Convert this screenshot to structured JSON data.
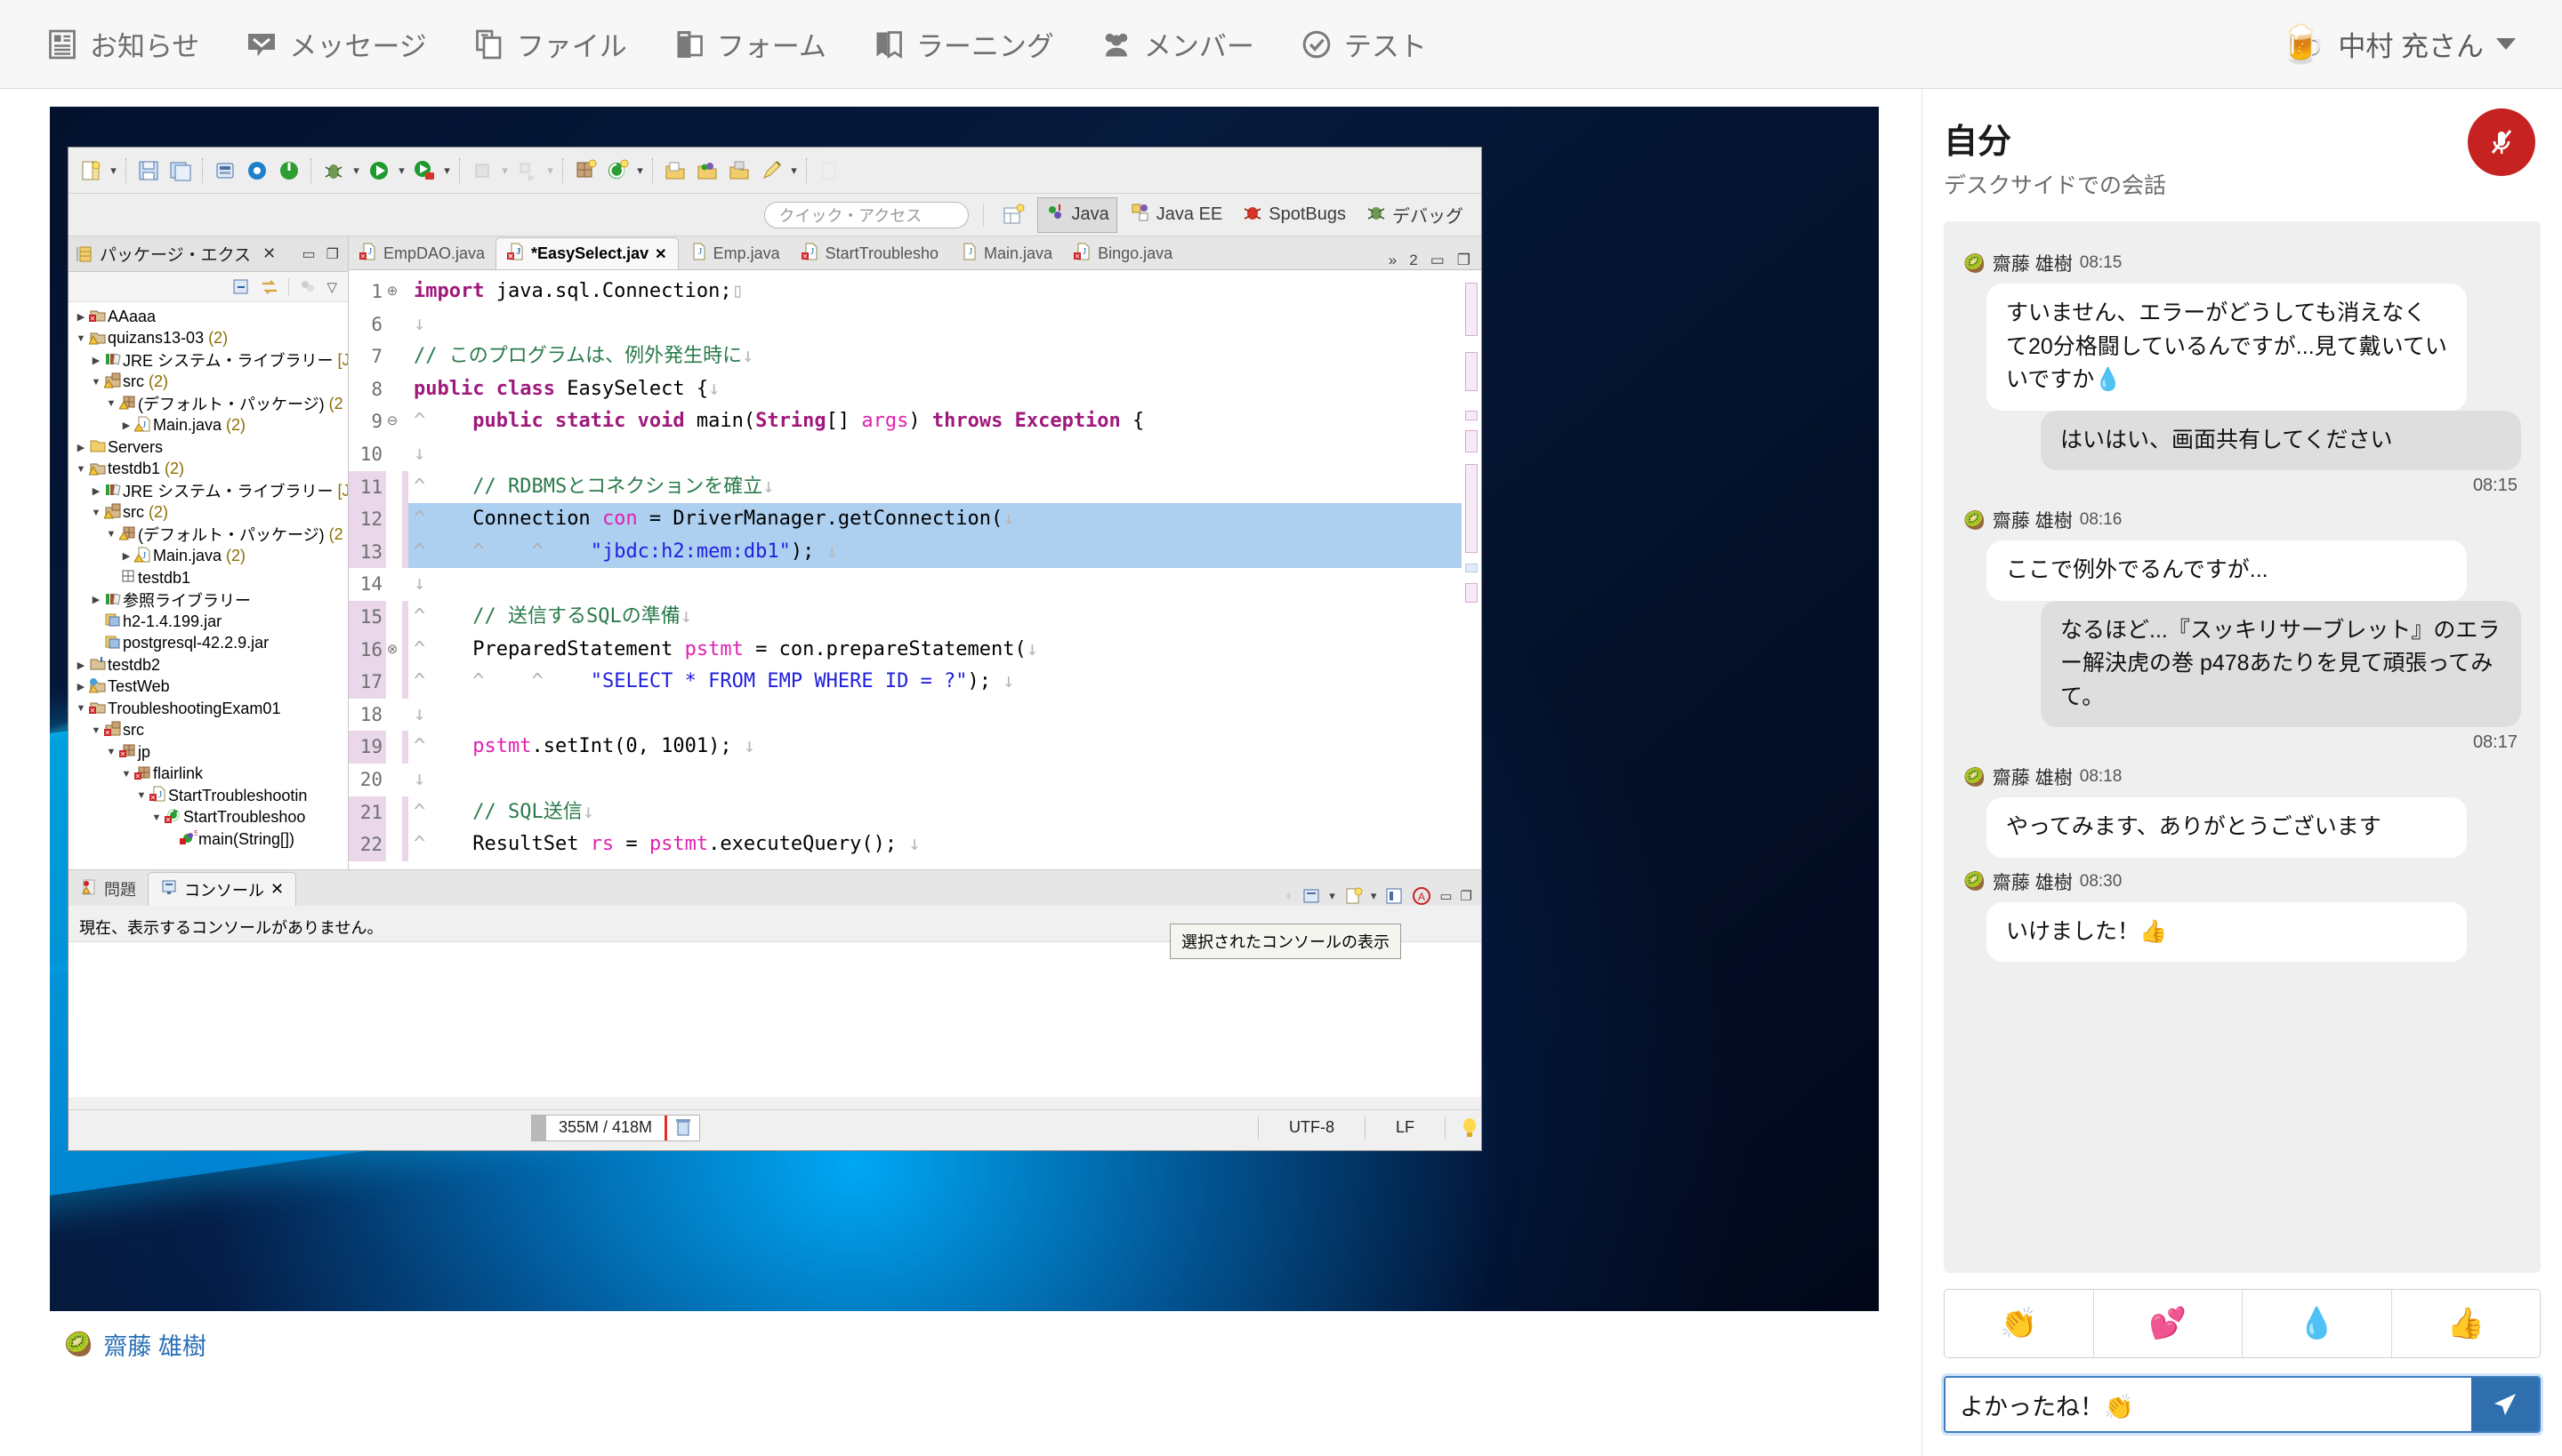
{
  "topnav": {
    "items": [
      {
        "label": "お知らせ",
        "icon": "announcement-icon"
      },
      {
        "label": "メッセージ",
        "icon": "message-icon"
      },
      {
        "label": "ファイル",
        "icon": "file-icon"
      },
      {
        "label": "フォーム",
        "icon": "form-icon"
      },
      {
        "label": "ラーニング",
        "icon": "learning-icon"
      },
      {
        "label": "メンバー",
        "icon": "members-icon"
      },
      {
        "label": "テスト",
        "icon": "test-icon"
      }
    ],
    "user": {
      "name": "中村 充さん",
      "avatar_emoji": "🍺"
    }
  },
  "eclipse": {
    "quick_access_placeholder": "クイック・アクセス",
    "perspectives": [
      {
        "label": "Java",
        "active": true
      },
      {
        "label": "Java EE",
        "active": false
      },
      {
        "label": "SpotBugs",
        "active": false
      },
      {
        "label": "デバッグ",
        "active": false
      }
    ],
    "package_explorer": {
      "title": "パッケージ・エクス",
      "tree": [
        {
          "indent": 0,
          "twist": "▶",
          "icon": "project-error-icon",
          "label": "AAaaa",
          "count": ""
        },
        {
          "indent": 0,
          "twist": "▼",
          "icon": "project-warn-icon",
          "label": "quizans13-03",
          "count": "(2)"
        },
        {
          "indent": 1,
          "twist": "▶",
          "icon": "library-icon",
          "label": "JRE システム・ライブラリー",
          "count": "[Ja"
        },
        {
          "indent": 1,
          "twist": "▼",
          "icon": "source-folder-icon",
          "label": "src",
          "count": "(2)"
        },
        {
          "indent": 2,
          "twist": "▼",
          "icon": "package-icon",
          "label": "(デフォルト・パッケージ)",
          "count": "(2"
        },
        {
          "indent": 3,
          "twist": "▶",
          "icon": "java-file-icon",
          "label": "Main.java",
          "count": "(2)"
        },
        {
          "indent": 0,
          "twist": "▶",
          "icon": "folder-icon",
          "label": "Servers",
          "count": ""
        },
        {
          "indent": 0,
          "twist": "▼",
          "icon": "project-warn-icon",
          "label": "testdb1",
          "count": "(2)"
        },
        {
          "indent": 1,
          "twist": "▶",
          "icon": "library-icon",
          "label": "JRE システム・ライブラリー",
          "count": "[Ja"
        },
        {
          "indent": 1,
          "twist": "▼",
          "icon": "source-folder-icon",
          "label": "src",
          "count": "(2)"
        },
        {
          "indent": 2,
          "twist": "▼",
          "icon": "package-icon",
          "label": "(デフォルト・パッケージ)",
          "count": "(2"
        },
        {
          "indent": 3,
          "twist": "▶",
          "icon": "java-file-icon",
          "label": "Main.java",
          "count": "(2)"
        },
        {
          "indent": 2,
          "twist": "",
          "icon": "package-plain-icon",
          "label": "testdb1",
          "count": ""
        },
        {
          "indent": 1,
          "twist": "▶",
          "icon": "library-icon",
          "label": "参照ライブラリー",
          "count": ""
        },
        {
          "indent": 1,
          "twist": "",
          "icon": "jar-icon",
          "label": "h2-1.4.199.jar",
          "count": ""
        },
        {
          "indent": 1,
          "twist": "",
          "icon": "jar-icon",
          "label": "postgresql-42.2.9.jar",
          "count": ""
        },
        {
          "indent": 0,
          "twist": "▶",
          "icon": "project-icon",
          "label": "testdb2",
          "count": ""
        },
        {
          "indent": 0,
          "twist": "▶",
          "icon": "web-project-icon",
          "label": "TestWeb",
          "count": ""
        },
        {
          "indent": 0,
          "twist": "▼",
          "icon": "project-error-icon",
          "label": "TroubleshootingExam01",
          "count": ""
        },
        {
          "indent": 1,
          "twist": "▼",
          "icon": "source-folder-error-icon",
          "label": "src",
          "count": ""
        },
        {
          "indent": 2,
          "twist": "▼",
          "icon": "package-error-icon",
          "label": "jp",
          "count": ""
        },
        {
          "indent": 3,
          "twist": "▼",
          "icon": "package-error-icon",
          "label": "flairlink",
          "count": ""
        },
        {
          "indent": 4,
          "twist": "▼",
          "icon": "java-file-error-icon",
          "label": "StartTroubleshootin",
          "count": ""
        },
        {
          "indent": 5,
          "twist": "▼",
          "icon": "class-error-icon",
          "label": "StartTroubleshoo",
          "count": ""
        },
        {
          "indent": 6,
          "twist": "",
          "icon": "method-static-icon",
          "label": "main(String[])",
          "count": ""
        }
      ]
    },
    "editor_tabs": [
      {
        "label": "EmpDAO.java",
        "active": false,
        "error": true
      },
      {
        "label": "*EasySelect.jav",
        "active": true,
        "error": true
      },
      {
        "label": "Emp.java",
        "active": false,
        "error": false
      },
      {
        "label": "StartTroublesho",
        "active": false,
        "error": true
      },
      {
        "label": "Main.java",
        "active": false,
        "error": false
      },
      {
        "label": "Bingo.java",
        "active": false,
        "error": true
      }
    ],
    "editor_overflow": "2",
    "code_lines": [
      {
        "num": "1",
        "fold": "⊕",
        "marker": "",
        "pink": false,
        "sel": false,
        "html": "<span class=\"k\">import</span> java.sql.Connection;<span class=\"crt\">▯</span>"
      },
      {
        "num": "6",
        "fold": "",
        "marker": "",
        "pink": false,
        "sel": false,
        "html": "<span class=\"arw\">↓</span>"
      },
      {
        "num": "7",
        "fold": "",
        "marker": "",
        "pink": false,
        "sel": false,
        "html": "<span class=\"cm\">// このプログラムは、例外発生時に</span><span class=\"arw\">↓</span>"
      },
      {
        "num": "8",
        "fold": "",
        "marker": "",
        "pink": false,
        "sel": false,
        "html": "<span class=\"k\">public class</span> EasySelect {<span class=\"arw\">↓</span>"
      },
      {
        "num": "9",
        "fold": "⊖",
        "marker": "^",
        "pink": false,
        "sel": false,
        "html": "    <span class=\"k\">public static void</span> main(<span class=\"k\">String</span>[] <span class=\"fld\">args</span>) <span class=\"k\">throws</span> <span class=\"k\">Exception</span> {"
      },
      {
        "num": "10",
        "fold": "",
        "marker": "",
        "pink": false,
        "sel": false,
        "html": "<span class=\"arw\">↓</span>"
      },
      {
        "num": "11",
        "fold": "",
        "marker": "^",
        "pink": true,
        "sel": false,
        "html": "    <span class=\"cm\">// RDBMSとコネクションを確立</span><span class=\"arw\">↓</span>"
      },
      {
        "num": "12",
        "fold": "",
        "marker": "^",
        "pink": true,
        "sel": true,
        "html": "    Connection <span class=\"fld\">con</span> = DriverManager.getConnection(<span class=\"arw\">↓</span>"
      },
      {
        "num": "13",
        "fold": "",
        "marker": "^",
        "pink": true,
        "sel": true,
        "html": "    <span class=\"crt\">^    ^</span>    <span class=\"str\">\"jbdc:h2:mem:db1\"</span>); <span class=\"arw\">↓</span>"
      },
      {
        "num": "14",
        "fold": "",
        "marker": "",
        "pink": false,
        "sel": false,
        "html": "<span class=\"arw\">↓</span>"
      },
      {
        "num": "15",
        "fold": "",
        "marker": "^",
        "pink": true,
        "sel": false,
        "html": "    <span class=\"cm\">// 送信するSQLの準備</span><span class=\"arw\">↓</span>"
      },
      {
        "num": "16",
        "fold": "⊗",
        "marker": "^",
        "pink": true,
        "sel": false,
        "html": "    PreparedStatement <span class=\"fld\">pstmt</span> = con.prepareStatement(<span class=\"arw\">↓</span>"
      },
      {
        "num": "17",
        "fold": "",
        "marker": "^",
        "pink": true,
        "sel": false,
        "html": "    <span class=\"crt\">^    ^</span>    <span class=\"str\">\"SELECT * FROM EMP WHERE ID = ?\"</span>); <span class=\"arw\">↓</span>"
      },
      {
        "num": "18",
        "fold": "",
        "marker": "",
        "pink": false,
        "sel": false,
        "html": "<span class=\"arw\">↓</span>"
      },
      {
        "num": "19",
        "fold": "",
        "marker": "^",
        "pink": true,
        "sel": false,
        "html": "    <span class=\"fld\">pstmt</span>.setInt(0, 1001); <span class=\"arw\">↓</span>"
      },
      {
        "num": "20",
        "fold": "",
        "marker": "",
        "pink": false,
        "sel": false,
        "html": "<span class=\"arw\">↓</span>"
      },
      {
        "num": "21",
        "fold": "",
        "marker": "^",
        "pink": true,
        "sel": false,
        "html": "    <span class=\"cm\">// SQL送信</span><span class=\"arw\">↓</span>"
      },
      {
        "num": "22",
        "fold": "",
        "marker": "^",
        "pink": true,
        "sel": false,
        "html": "    ResultSet <span class=\"fld\">rs</span> = <span class=\"fld\">pstmt</span>.executeQuery(); <span class=\"arw\">↓</span>"
      }
    ],
    "console": {
      "tabs": [
        {
          "label": "問題",
          "active": false
        },
        {
          "label": "コンソール",
          "active": true
        }
      ],
      "body_text": "現在、表示するコンソールがありません。",
      "tooltip": "選択されたコンソールの表示"
    },
    "statusbar": {
      "memory": "355M / 418M",
      "encoding": "UTF-8",
      "line_ending": "LF"
    }
  },
  "presenter": {
    "name": "齋藤 雄樹",
    "avatar_emoji": "🥝"
  },
  "chat": {
    "title": "自分",
    "subtitle": "デスクサイドでの会話",
    "mic_icon": "mic-off-icon",
    "messages": [
      {
        "side": "them",
        "sender": "齋藤 雄樹",
        "avatar_emoji": "🥝",
        "time": "08:15",
        "text": "すいません、エラーがどうしても消えなくて20分格闘しているんですが...見て戴いていいですか💧"
      },
      {
        "side": "me",
        "time": "08:15",
        "text": "はいはい、画面共有してください"
      },
      {
        "side": "them",
        "sender": "齋藤 雄樹",
        "avatar_emoji": "🥝",
        "time": "08:16",
        "text": "ここで例外でるんですが..."
      },
      {
        "side": "me",
        "time": "08:17",
        "text": "なるほど...『スッキリサーブレット』のエラー解決虎の巻 p478あたりを見て頑張ってみて。"
      },
      {
        "side": "them",
        "sender": "齋藤 雄樹",
        "avatar_emoji": "🥝",
        "time": "08:18",
        "text": "やってみます、ありがとうございます"
      },
      {
        "side": "them",
        "sender": "齋藤 雄樹",
        "avatar_emoji": "🥝",
        "time": "08:30",
        "text": "いけました！👍"
      }
    ],
    "emoji_buttons": [
      "👏",
      "💕",
      "💧",
      "👍"
    ],
    "composer": {
      "value": "よかったね！👏",
      "send_icon": "send-icon"
    }
  },
  "colors": {
    "mic_red": "#c62222",
    "send_blue": "#2f6fae",
    "selection_blue": "#adcff0",
    "keyword": "#a0187c",
    "comment": "#2a7a4b",
    "string": "#2020e0",
    "field": "#e020b0"
  }
}
